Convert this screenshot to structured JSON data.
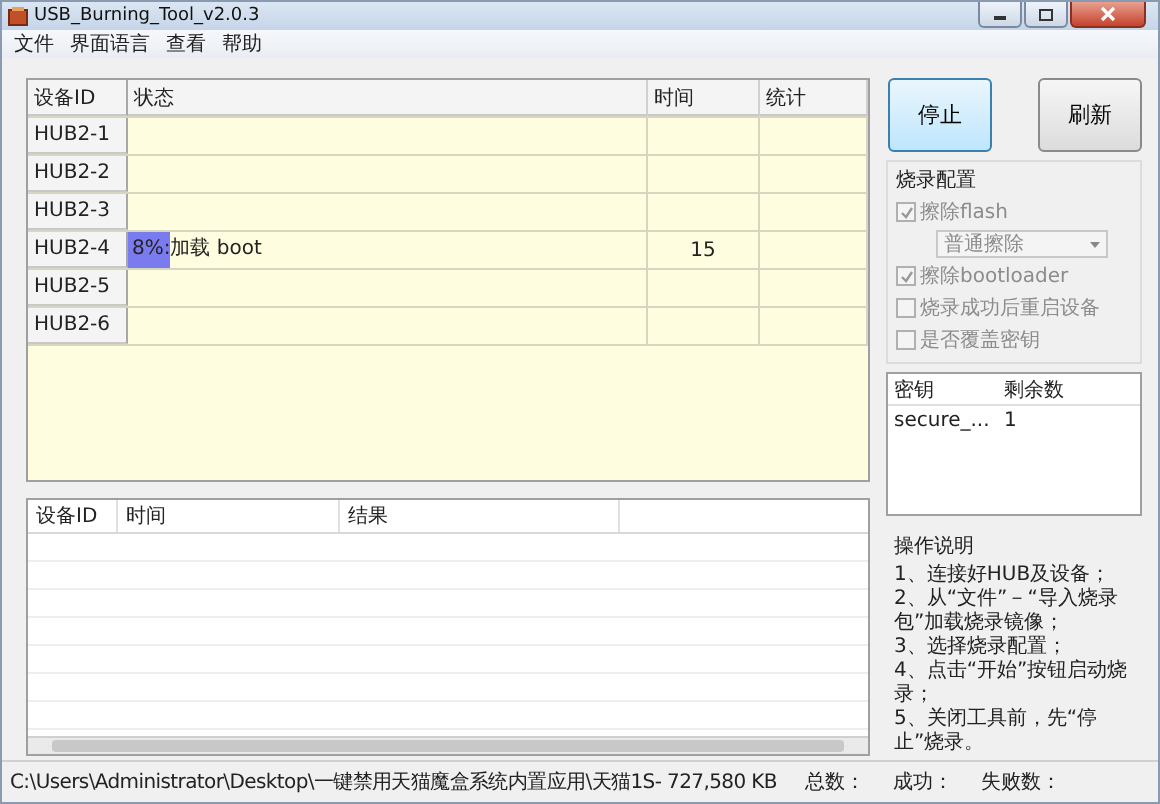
{
  "window": {
    "title": "USB_Burning_Tool_v2.0.3"
  },
  "menu": [
    "文件",
    "界面语言",
    "查看",
    "帮助"
  ],
  "device_table": {
    "columns": [
      "设备ID",
      "状态",
      "时间",
      "统计"
    ],
    "rows": [
      {
        "device_id": "HUB2-1"
      },
      {
        "device_id": "HUB2-2"
      },
      {
        "device_id": "HUB2-3"
      },
      {
        "device_id": "HUB2-4",
        "progress": {
          "level": 0.08,
          "text": "8%:加载 boot"
        },
        "time": "15"
      },
      {
        "device_id": "HUB2-5"
      },
      {
        "device_id": "HUB2-6"
      }
    ]
  },
  "log_table": {
    "columns": [
      "设备ID",
      "时间",
      "结果"
    ]
  },
  "buttons": [
    {
      "label": "停止",
      "focused": true
    },
    {
      "label": "刷新",
      "focused": false
    }
  ],
  "burn_config": {
    "title": "烧录配置",
    "options": [
      {
        "kind": "checkbox",
        "label": "擦除flash",
        "checked": true,
        "disabled": true
      },
      {
        "kind": "dropdown",
        "value": "普通擦除",
        "disabled": true
      },
      {
        "kind": "checkbox",
        "label": "擦除bootloader",
        "checked": true,
        "disabled": true
      },
      {
        "kind": "checkbox",
        "label": "烧录成功后重启设备",
        "checked": false,
        "disabled": true
      },
      {
        "kind": "checkbox",
        "label": "是否覆盖密钥",
        "checked": false,
        "disabled": true
      }
    ]
  },
  "key_table": {
    "columns": [
      "密钥",
      "剩余数"
    ],
    "rows": [
      [
        "secure_...",
        "1"
      ]
    ]
  },
  "instructions": {
    "title": "操作说明",
    "steps": [
      "1、连接好HUB及设备；",
      "2、从“文件”－“导入烧录包”加载烧录镜像；",
      "3、选择烧录配置；",
      "4、点击“开始”按钮启动烧录；",
      "5、关闭工具前，先“停止”烧录。"
    ]
  },
  "status_bar": {
    "path": "C:\\Users\\Administrator\\Desktop\\一键禁用天猫魔盒系统内置应用\\天猫1S- 727,580 KB",
    "total_label": "总数：",
    "success_label": "成功：",
    "failed_label": "失败数："
  }
}
